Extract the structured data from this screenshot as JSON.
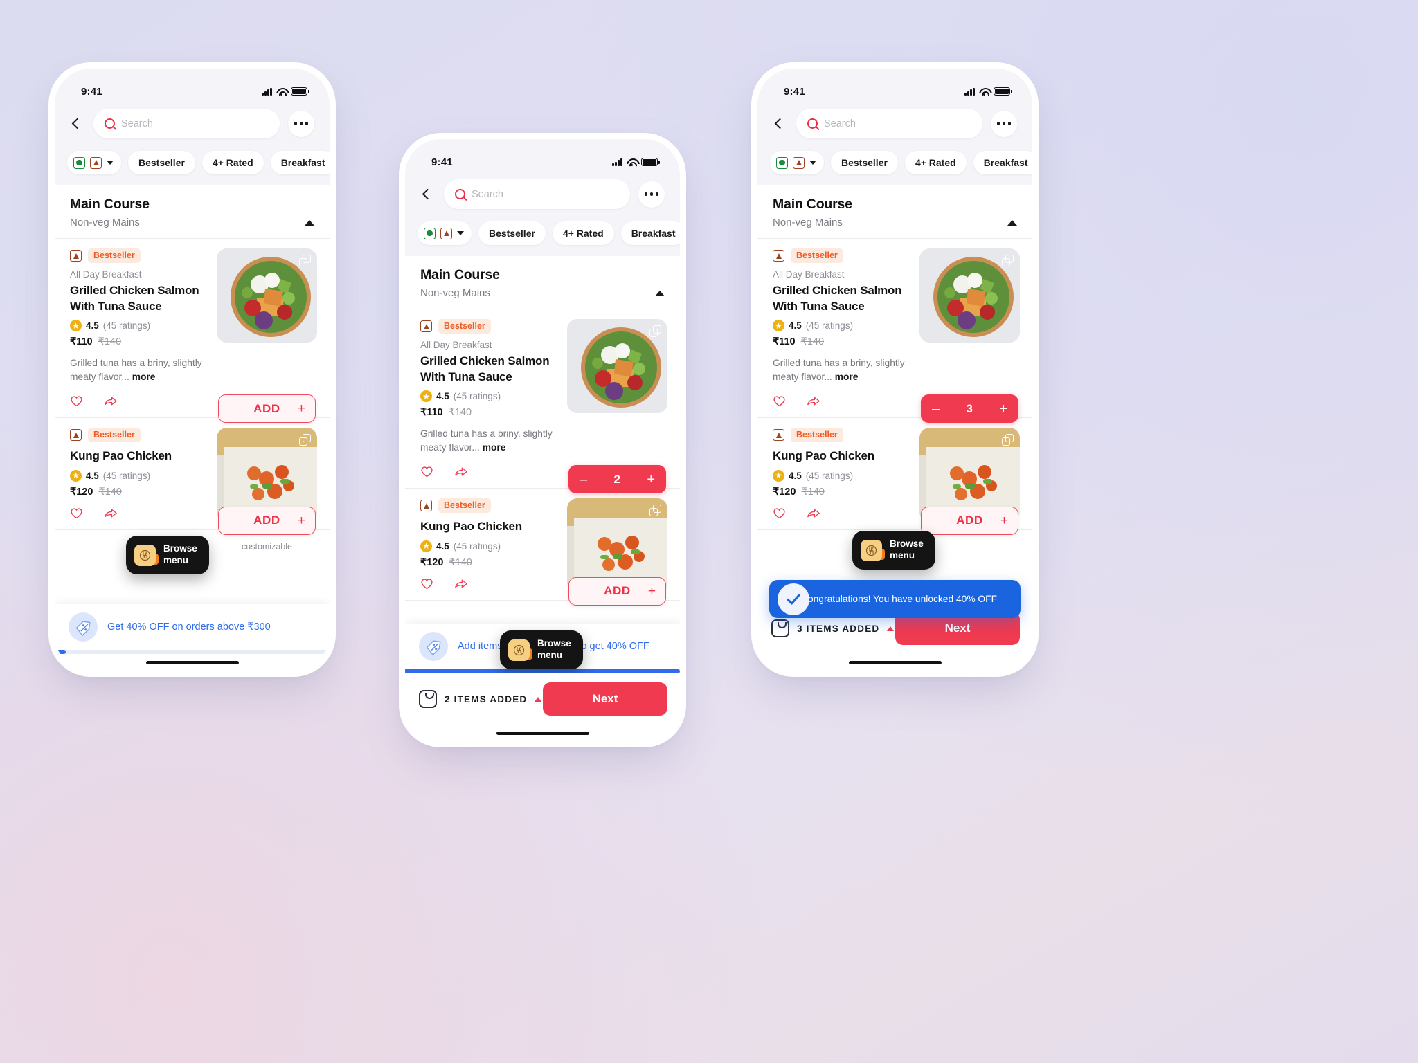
{
  "theme": {
    "accent": "#ef3a50",
    "blue": "#2f6bea",
    "veg_green": "#1a8a3c",
    "nonveg_brown": "#9c4321",
    "bestseller_orange": "#ef5b25"
  },
  "status_bar": {
    "time": "9:41"
  },
  "search": {
    "placeholder": "Search"
  },
  "filters": {
    "veg_label": "veg-nonveg-filter",
    "chips": [
      "Bestseller",
      "4+ Rated",
      "Breakfast"
    ]
  },
  "section": {
    "title": "Main Course",
    "subtitle": "Non-veg Mains"
  },
  "items": [
    {
      "badge": "Bestseller",
      "category": "All Day Breakfast",
      "name": "Grilled Chicken Salmon With Tuna Sauce",
      "rating": "4.5",
      "rating_count": "(45 ratings)",
      "price": "₹110",
      "price_old": "₹140",
      "description": "Grilled tuna has a briny, slightly meaty flavor...",
      "description_more": "more",
      "add_label": "ADD",
      "add_plus": "+",
      "customizable": "customizable"
    },
    {
      "badge": "Bestseller",
      "category": "",
      "name": "Kung Pao Chicken",
      "rating": "4.5",
      "rating_count": "(45 ratings)",
      "price": "₹120",
      "price_old": "₹140",
      "description": "",
      "description_more": "",
      "add_label": "ADD",
      "add_plus": "+",
      "customizable": "customizable"
    }
  ],
  "browse_tooltip": {
    "line1": "Browse",
    "line2": "menu"
  },
  "phone1": {
    "offer": {
      "text": "Get 40% OFF on orders above ₹300",
      "progress_pct": 4
    }
  },
  "phone2": {
    "quantity": "2",
    "stepper_minus": "–",
    "stepper_plus": "+",
    "offer": {
      "text": "Add items worth ₹80 more to get 40% OFF",
      "progress_pct": 100
    },
    "cart": {
      "items_added": "2 ITEMS ADDED",
      "next_label": "Next"
    }
  },
  "phone3": {
    "quantity": "3",
    "stepper_minus": "–",
    "stepper_plus": "+",
    "congrats": "Congratulations! You have unlocked 40% OFF",
    "cart": {
      "items_added": "3 ITEMS ADDED",
      "next_label": "Next"
    }
  }
}
